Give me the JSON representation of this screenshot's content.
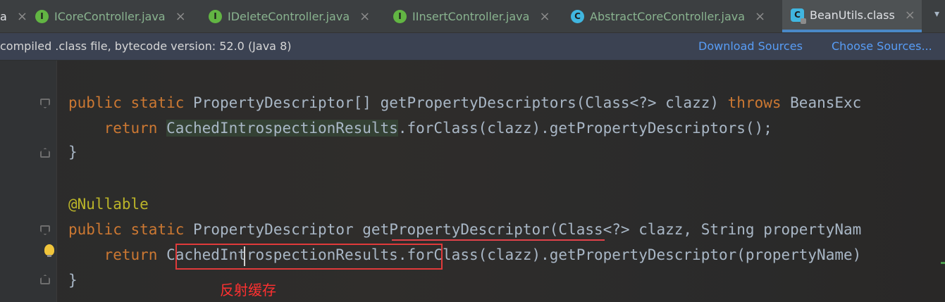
{
  "tabs": [
    {
      "label": "a",
      "icon": "none",
      "close": "×"
    },
    {
      "label": "ICoreController.java",
      "icon": "interface-icon",
      "icon_char": "I",
      "close": "×"
    },
    {
      "label": "IDeleteController.java",
      "icon": "interface-icon",
      "icon_char": "I",
      "close": "×"
    },
    {
      "label": "IInsertController.java",
      "icon": "interface-icon",
      "icon_char": "I",
      "close": "×"
    },
    {
      "label": "AbstractCoreController.java",
      "icon": "class-icon",
      "icon_char": "C",
      "close": "×"
    },
    {
      "label": "BeanUtils.class",
      "icon": "class-file-icon",
      "icon_char": "C",
      "close": "×",
      "active": true
    }
  ],
  "tabs_more": "▾",
  "notice": {
    "text": "compiled .class file, bytecode version: 52.0 (Java 8)",
    "download_sources": "Download Sources",
    "choose_sources": "Choose Sources..."
  },
  "code": {
    "l1": {
      "kw1": "public",
      "kw2": "static",
      "type": "PropertyDescriptor[]",
      "fn": "getPropertyDescriptors",
      "params": "(Class<?> clazz) ",
      "kw3": "throws",
      "rest": " BeansExc"
    },
    "l2": {
      "kw": "return",
      "type": "CachedIntrospectionResults",
      "rest": ".forClass(clazz).getPropertyDescriptors();"
    },
    "l3": {
      "text": "}"
    },
    "l4": {
      "annotation": "@Nullable"
    },
    "l5": {
      "kw1": "public",
      "kw2": "static",
      "type": "PropertyDescriptor",
      "fn": "getPropertyDescriptor",
      "params": "(Class<?> clazz, String propertyNam"
    },
    "l6": {
      "kw": "return",
      "type": "CachedIntrospectionResults",
      "rest": ".forClass(clazz).getPropertyDescriptor(propertyName)"
    },
    "l7": {
      "text": "}"
    }
  },
  "annotation_label": "反射缓存",
  "colors": {
    "keyword": "#cc7832",
    "annotation": "#bbb529",
    "method": "#ffc66d",
    "default_text": "#a9b7c6",
    "link": "#589df6",
    "red_markup": "#e03a3a"
  }
}
